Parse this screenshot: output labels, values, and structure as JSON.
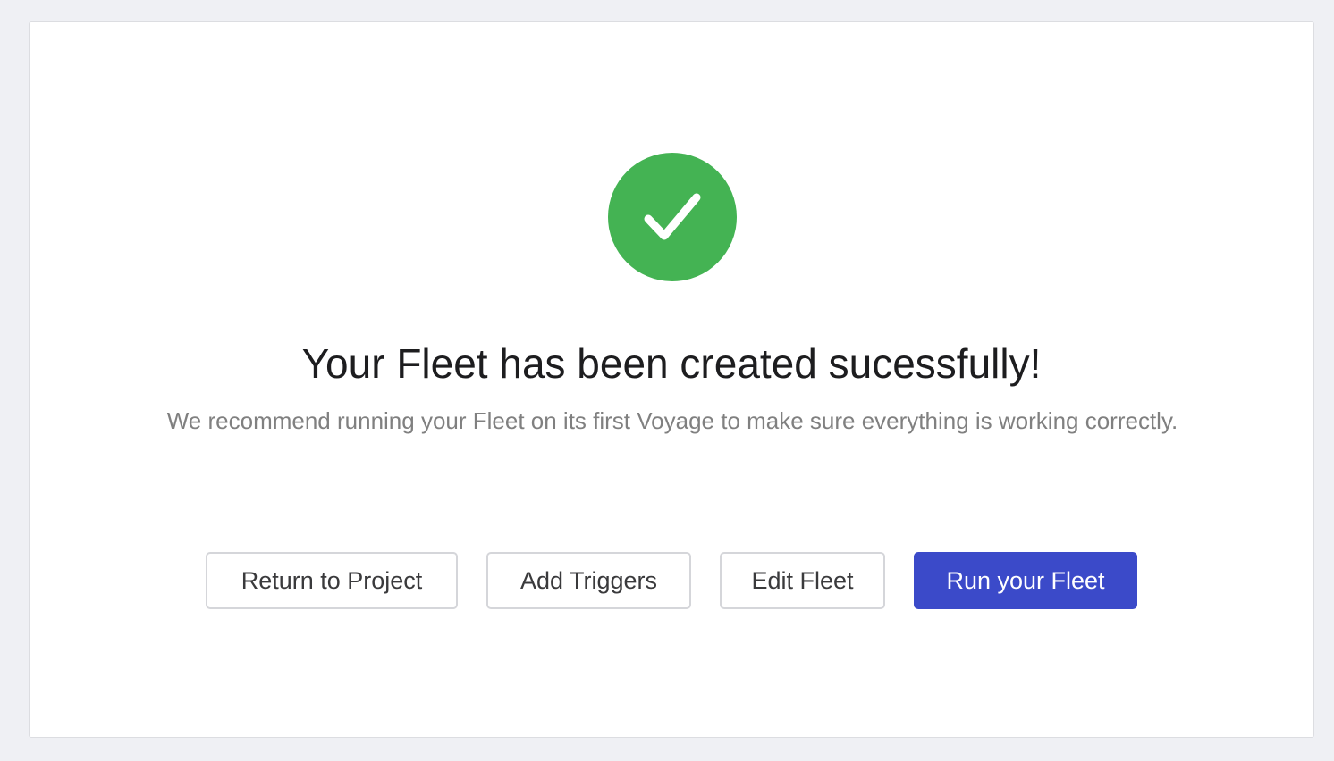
{
  "status": {
    "icon": "check-circle-icon",
    "icon_color": "#44b353"
  },
  "message": {
    "title": "Your Fleet has been created sucessfully!",
    "subtitle": "We recommend running your Fleet on its first Voyage to make sure everything is working correctly."
  },
  "actions": {
    "return_label": "Return to Project",
    "triggers_label": "Add Triggers",
    "edit_label": "Edit Fleet",
    "run_label": "Run your Fleet"
  },
  "colors": {
    "primary": "#3b4ac9",
    "success": "#44b353",
    "background": "#eff0f4"
  }
}
